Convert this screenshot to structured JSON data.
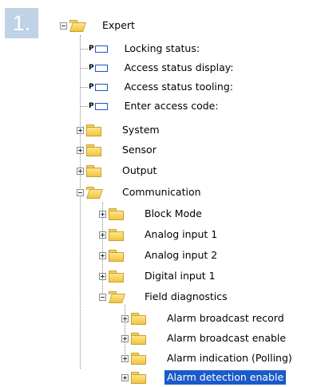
{
  "step_number": "1.",
  "tree": {
    "root": {
      "label": "Expert",
      "state": "expanded"
    },
    "expert_params": [
      {
        "key": "locking_status",
        "label": "Locking status:"
      },
      {
        "key": "access_status_display",
        "label": "Access status display:"
      },
      {
        "key": "access_status_tooling",
        "label": "Access status tooling:"
      },
      {
        "key": "enter_access_code",
        "label": "Enter access code:"
      }
    ],
    "expert_folders": [
      {
        "key": "system",
        "label": "System",
        "state": "collapsed"
      },
      {
        "key": "sensor",
        "label": "Sensor",
        "state": "collapsed"
      },
      {
        "key": "output",
        "label": "Output",
        "state": "collapsed"
      },
      {
        "key": "communication",
        "label": "Communication",
        "state": "expanded"
      }
    ],
    "communication_folders": [
      {
        "key": "block_mode",
        "label": "Block Mode",
        "state": "collapsed"
      },
      {
        "key": "analog_input_1",
        "label": "Analog input 1",
        "state": "collapsed"
      },
      {
        "key": "analog_input_2",
        "label": "Analog input 2",
        "state": "collapsed"
      },
      {
        "key": "digital_input_1",
        "label": "Digital input 1",
        "state": "collapsed"
      },
      {
        "key": "field_diagnostics",
        "label": "Field diagnostics",
        "state": "expanded"
      }
    ],
    "field_diagnostics_folders": [
      {
        "key": "alarm_broadcast_record",
        "label": "Alarm broadcast record",
        "state": "collapsed"
      },
      {
        "key": "alarm_broadcast_enable",
        "label": "Alarm broadcast enable",
        "state": "collapsed"
      },
      {
        "key": "alarm_indication_polling",
        "label": "Alarm indication (Polling)",
        "state": "collapsed"
      },
      {
        "key": "alarm_detection_enable",
        "label": "Alarm detection enable",
        "state": "collapsed",
        "selected": true
      }
    ],
    "param_icon_letter": "P",
    "selection_color": "#1b5ac9"
  }
}
